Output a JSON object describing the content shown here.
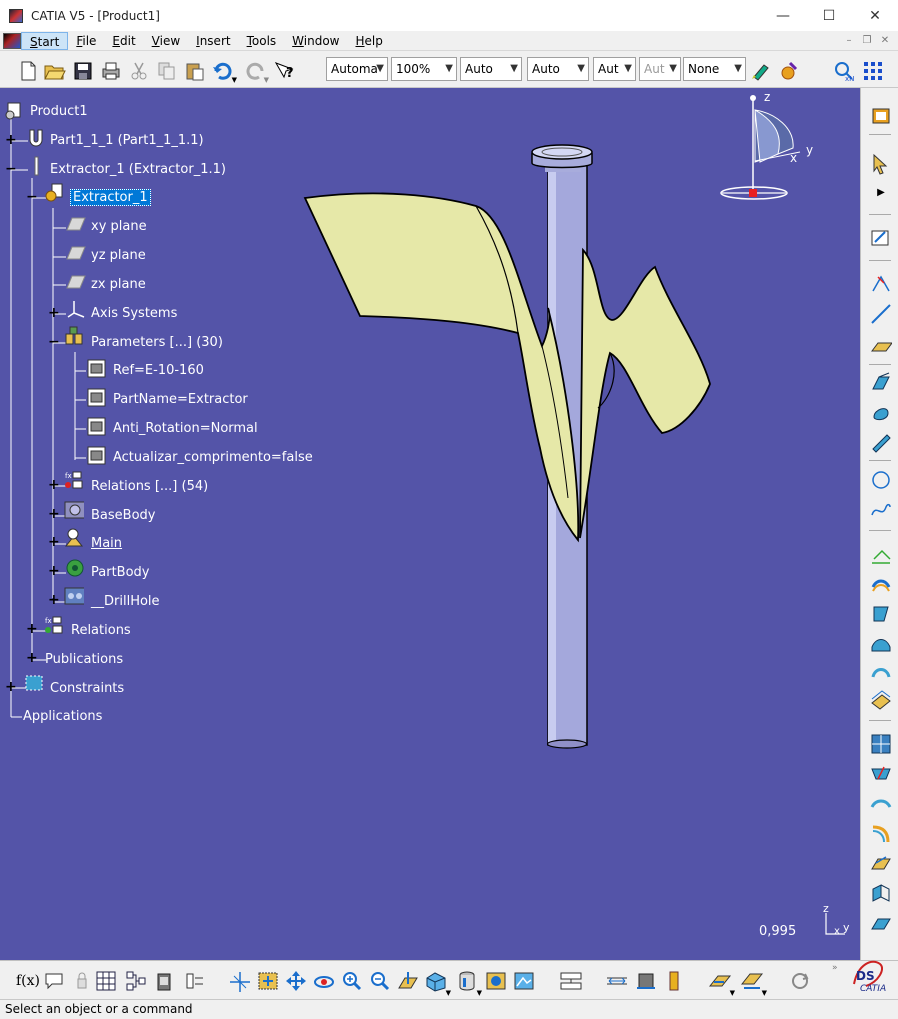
{
  "window": {
    "title": "CATIA V5 - [Product1]",
    "minimize": "—",
    "maximize": "☐",
    "close": "✕"
  },
  "menu": [
    {
      "label": "Start",
      "accel": "S"
    },
    {
      "label": "File",
      "accel": "F"
    },
    {
      "label": "Edit",
      "accel": "E"
    },
    {
      "label": "View",
      "accel": "V"
    },
    {
      "label": "Insert",
      "accel": "I"
    },
    {
      "label": "Tools",
      "accel": "T"
    },
    {
      "label": "Window",
      "accel": "W"
    },
    {
      "label": "Help",
      "accel": "H"
    }
  ],
  "toolbar": {
    "combos": [
      {
        "value": "Automa"
      },
      {
        "value": "100%"
      },
      {
        "value": "Auto"
      },
      {
        "value": "Auto"
      },
      {
        "value": "Aut"
      },
      {
        "value": "Aut"
      },
      {
        "value": "None"
      }
    ]
  },
  "tree": {
    "root": "Product1",
    "part": "Part1_1_1 (Part1_1_1.1)",
    "extractor": "Extractor_1 (Extractor_1.1)",
    "extractor_part": "Extractor_1",
    "xy": "xy plane",
    "yz": "yz plane",
    "zx": "zx plane",
    "axis": "Axis Systems",
    "params": "Parameters [...] (30)",
    "p1": "Ref=E-10-160",
    "p2": "PartName=Extractor",
    "p3": "Anti_Rotation=Normal",
    "p4": "Actualizar_comprimento=false",
    "rel_inner": "Relations [...] (54)",
    "basebody": "BaseBody",
    "main": "Main",
    "partbody": "PartBody",
    "drillhole": "__DrillHole",
    "relations": "Relations",
    "publications": "Publications",
    "constraints": "Constraints",
    "applications": "Applications"
  },
  "viewport": {
    "zoom": "0,995",
    "compass": {
      "z": "z",
      "x": "x",
      "y": "y"
    },
    "axis": {
      "z": "z",
      "x": "x",
      "y": "y"
    },
    "background": "#5454a8",
    "surface_color": "#e6e8a8",
    "pin_color": "#b0b4e0"
  },
  "status": "Select an object or a command",
  "bottom": {
    "fx": "f(x)"
  }
}
